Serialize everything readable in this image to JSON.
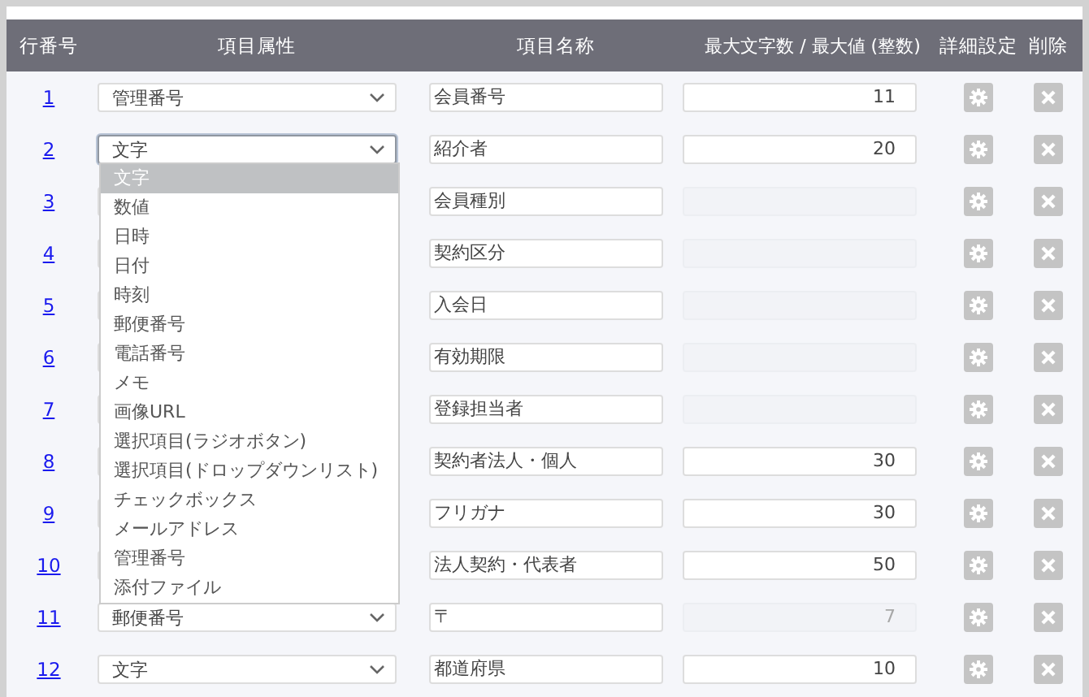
{
  "columns": [
    "行番号",
    "項目属性",
    "項目名称",
    "最大文字数 / 最大値 (整数)",
    "詳細設定",
    "削除"
  ],
  "rows": [
    {
      "number": "1",
      "type": "管理番号",
      "open": false,
      "name": "会員番号",
      "max": "11",
      "max_disabled": false
    },
    {
      "number": "2",
      "type": "文字",
      "open": true,
      "name": "紹介者",
      "max": "20",
      "max_disabled": false
    },
    {
      "number": "3",
      "open": false,
      "name": "会員種別",
      "max_disabled": true
    },
    {
      "number": "4",
      "open": false,
      "name": "契約区分",
      "max_disabled": true
    },
    {
      "number": "5",
      "open": false,
      "name": "入会日",
      "max_disabled": true
    },
    {
      "number": "6",
      "open": false,
      "name": "有効期限",
      "max_disabled": true
    },
    {
      "number": "7",
      "open": false,
      "name": "登録担当者",
      "max_disabled": true
    },
    {
      "number": "8",
      "open": false,
      "name": "契約者法人・個人",
      "max": "30",
      "max_disabled": false
    },
    {
      "number": "9",
      "open": false,
      "name": "フリガナ",
      "max": "30",
      "max_disabled": false
    },
    {
      "number": "10",
      "open": false,
      "name": "法人契約・代表者",
      "max": "50",
      "max_disabled": false
    },
    {
      "number": "11",
      "type": "郵便番号",
      "open": false,
      "name": "〒",
      "max": "7",
      "max_disabled": true
    },
    {
      "number": "12",
      "type": "文字",
      "open": false,
      "name": "都道府県",
      "max": "10",
      "max_disabled": false
    }
  ],
  "dropdown_options": [
    {
      "label": "文字",
      "selected": true
    },
    {
      "label": "数値",
      "selected": false
    },
    {
      "label": "日時",
      "selected": false
    },
    {
      "label": "日付",
      "selected": false
    },
    {
      "label": "時刻",
      "selected": false
    },
    {
      "label": "郵便番号",
      "selected": false
    },
    {
      "label": "電話番号",
      "selected": false
    },
    {
      "label": "メモ",
      "selected": false
    },
    {
      "label": "画像URL",
      "selected": false
    },
    {
      "label": "選択項目(ラジオボタン)",
      "selected": false
    },
    {
      "label": "選択項目(ドロップダウンリスト)",
      "selected": false
    },
    {
      "label": "チェックボックス",
      "selected": false
    },
    {
      "label": "メールアドレス",
      "selected": false
    },
    {
      "label": "管理番号",
      "selected": false
    },
    {
      "label": "添付ファイル",
      "selected": false
    }
  ]
}
